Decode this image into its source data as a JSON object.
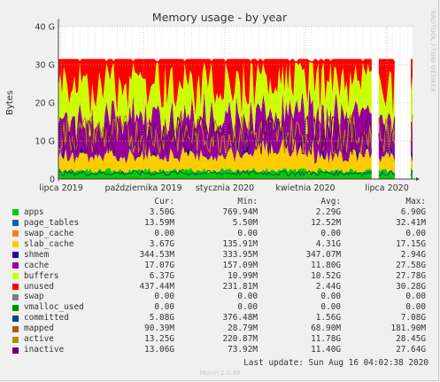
{
  "chart_data": {
    "type": "area",
    "title": "Memory usage - by year",
    "ylabel": "Bytes",
    "side_label": "RRDTOOL / TOBI OETIKER",
    "ylim": [
      0,
      40
    ],
    "y_unit": "G",
    "yticks": [
      "0",
      "10 G",
      "20 G",
      "30 G",
      "40 G"
    ],
    "xticks": [
      "lipca 2019",
      "października 2019",
      "stycznia 2020",
      "kwietnia 2020",
      "lipca 2020"
    ],
    "grid": true,
    "stack_order": [
      "apps",
      "page_tables",
      "swap_cache",
      "slab_cache",
      "shmem",
      "cache",
      "buffers",
      "unused",
      "swap",
      "vmalloc_used"
    ],
    "line_series": [
      "committed",
      "mapped",
      "active",
      "inactive"
    ],
    "series": [
      {
        "name": "apps",
        "color": "#00cc00",
        "cur": "3.50G",
        "min": "769.94M",
        "avg": "2.29G",
        "max": "6.90G",
        "typical": 2.3
      },
      {
        "name": "page_tables",
        "color": "#0066b3",
        "cur": "13.59M",
        "min": "5.50M",
        "avg": "12.52M",
        "max": "32.41M",
        "typical": 0.0125
      },
      {
        "name": "swap_cache",
        "color": "#ff8000",
        "cur": "0.00",
        "min": "0.00",
        "avg": "0.00",
        "max": "0.00",
        "typical": 0
      },
      {
        "name": "slab_cache",
        "color": "#ffcc00",
        "cur": "3.67G",
        "min": "135.91M",
        "avg": "4.31G",
        "max": "17.15G",
        "typical": 4.31
      },
      {
        "name": "shmem",
        "color": "#330099",
        "cur": "344.53M",
        "min": "333.95M",
        "avg": "347.07M",
        "max": "2.94G",
        "typical": 0.347
      },
      {
        "name": "cache",
        "color": "#990099",
        "cur": "17.07G",
        "min": "157.09M",
        "avg": "11.80G",
        "max": "27.58G",
        "typical": 11.8
      },
      {
        "name": "buffers",
        "color": "#ccff00",
        "cur": "6.37G",
        "min": "10.99M",
        "avg": "10.52G",
        "max": "27.78G",
        "typical": 10.52
      },
      {
        "name": "unused",
        "color": "#ff0000",
        "cur": "437.44M",
        "min": "231.81M",
        "avg": "2.44G",
        "max": "30.28G",
        "typical": 2.44
      },
      {
        "name": "swap",
        "color": "#808080",
        "cur": "0.00",
        "min": "0.00",
        "avg": "0.00",
        "max": "0.00",
        "typical": 0
      },
      {
        "name": "vmalloc_used",
        "color": "#008f00",
        "cur": "0.00",
        "min": "0.00",
        "avg": "0.00",
        "max": "0.00",
        "typical": 0
      },
      {
        "name": "committed",
        "color": "#00487d",
        "cur": "5.08G",
        "min": "376.48M",
        "avg": "1.56G",
        "max": "7.08G",
        "typical": 1.56
      },
      {
        "name": "mapped",
        "color": "#b35a00",
        "cur": "90.39M",
        "min": "28.79M",
        "avg": "68.90M",
        "max": "181.90M",
        "typical": 0.069
      },
      {
        "name": "active",
        "color": "#b38f00",
        "cur": "13.25G",
        "min": "220.87M",
        "avg": "11.78G",
        "max": "28.45G",
        "typical": 11.78
      },
      {
        "name": "inactive",
        "color": "#6b006b",
        "cur": "13.06G",
        "min": "73.92M",
        "avg": "11.40G",
        "max": "27.64G",
        "typical": 11.4
      }
    ]
  },
  "legend": {
    "headers": {
      "cur": "Cur:",
      "min": "Min:",
      "avg": "Avg:",
      "max": "Max:"
    },
    "last_update": "Last update: Sun Aug 16 04:02:38 2020",
    "footer": "Munin 2.0.49"
  }
}
